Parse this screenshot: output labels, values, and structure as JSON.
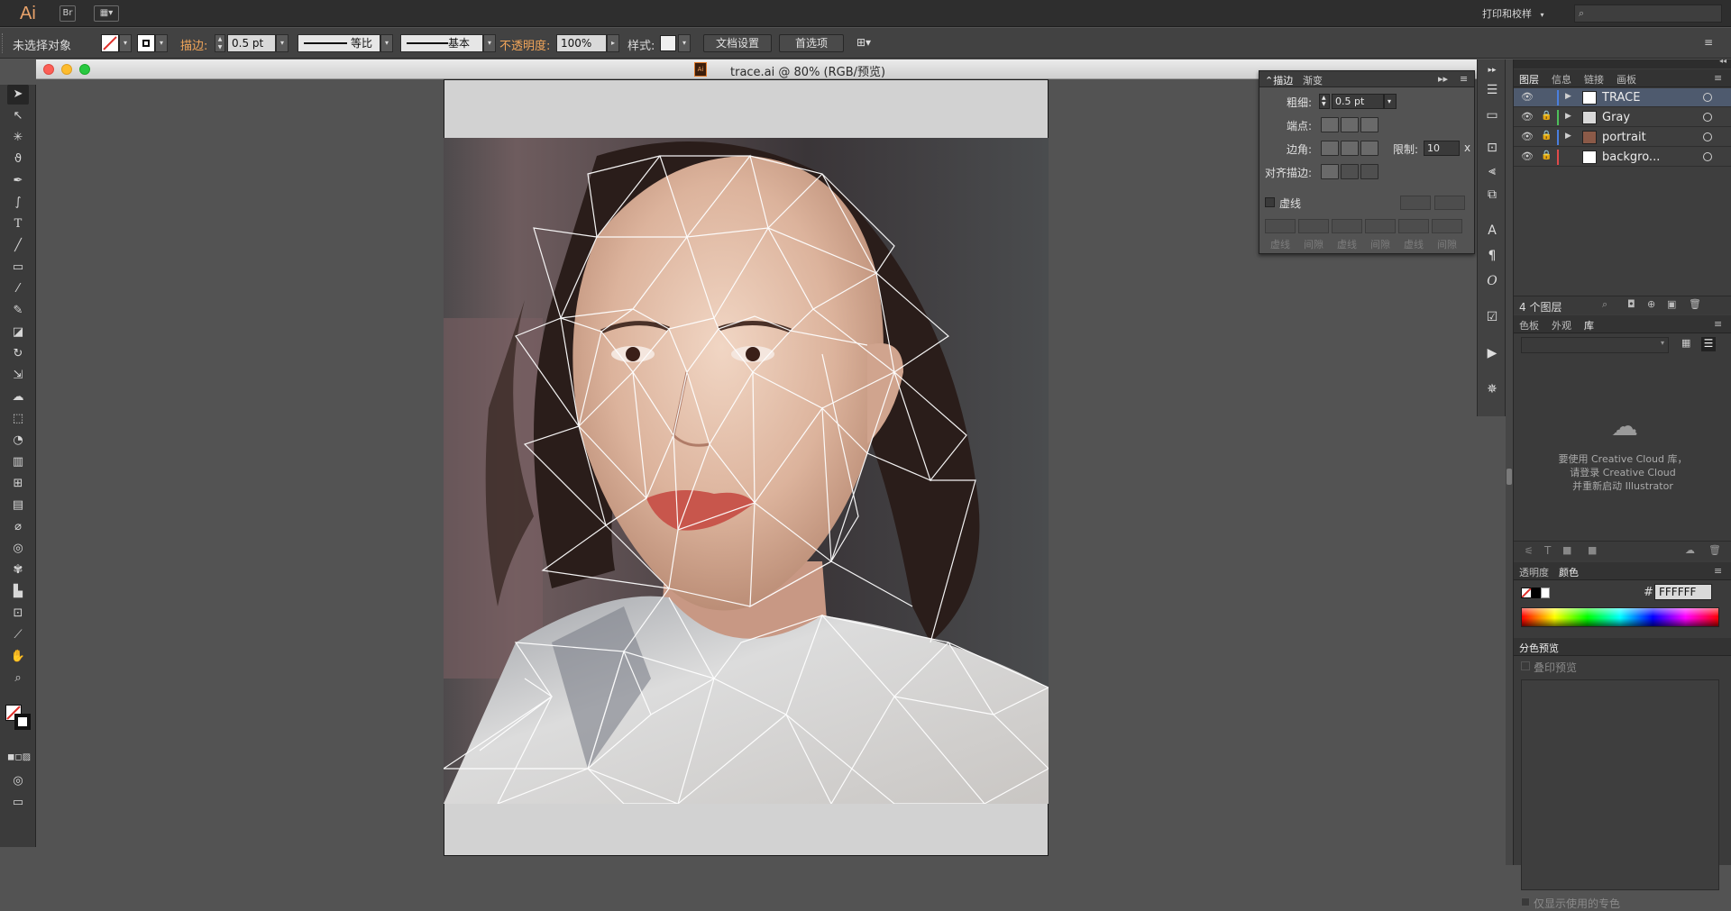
{
  "app": {
    "logo": "Ai",
    "bridge": "Br",
    "workspace_label": "打印和校样",
    "search_placeholder": ""
  },
  "control_bar": {
    "selection_status": "未选择对象",
    "stroke_label": "描边:",
    "stroke_weight": "0.5 pt",
    "profile_label": "等比",
    "brush_label": "基本",
    "opacity_label": "不透明度:",
    "opacity_value": "100%",
    "style_label": "样式:",
    "doc_setup_button": "文档设置",
    "preferences_button": "首选项"
  },
  "document": {
    "title": "trace.ai @ 80% (RGB/预览)"
  },
  "stroke_panel": {
    "tabs": [
      "描边",
      "渐变"
    ],
    "weight_label": "粗细:",
    "weight_value": "0.5 pt",
    "cap_label": "端点:",
    "corner_label": "边角:",
    "limit_label": "限制:",
    "limit_value": "10",
    "limit_unit": "x",
    "align_label": "对齐描边:",
    "dashed_label": "虚线",
    "dash_labels": [
      "虚线",
      "间隙",
      "虚线",
      "间隙",
      "虚线",
      "间隙"
    ]
  },
  "layers_panel": {
    "tabs": [
      "图层",
      "信息",
      "链接",
      "画板"
    ],
    "layers": [
      {
        "name": "TRACE",
        "color": "#4a7fe0",
        "selected": true
      },
      {
        "name": "Gray",
        "color": "#4ec05a",
        "selected": false
      },
      {
        "name": "portrait",
        "color": "#4a7fe0",
        "selected": false
      },
      {
        "name": "backgro...",
        "color": "#e04a4a",
        "selected": false
      }
    ],
    "count_label": "4 个图层"
  },
  "library_panel": {
    "tabs": [
      "色板",
      "外观",
      "库"
    ],
    "message_line1": "要使用 Creative Cloud 库，",
    "message_line2": "请登录 Creative Cloud",
    "message_line3": "并重新启动 Illustrator"
  },
  "color_panel": {
    "tabs": [
      "透明度",
      "颜色"
    ],
    "hash": "#",
    "hex_value": "FFFFFF"
  },
  "separation_panel": {
    "tab": "分色预览",
    "overprint_label": "叠印预览",
    "spot_only_label": "仅显示使用的专色"
  },
  "colors": {
    "accent_orange": "#f2a65a",
    "selected_layer": "#4e5a6e"
  }
}
